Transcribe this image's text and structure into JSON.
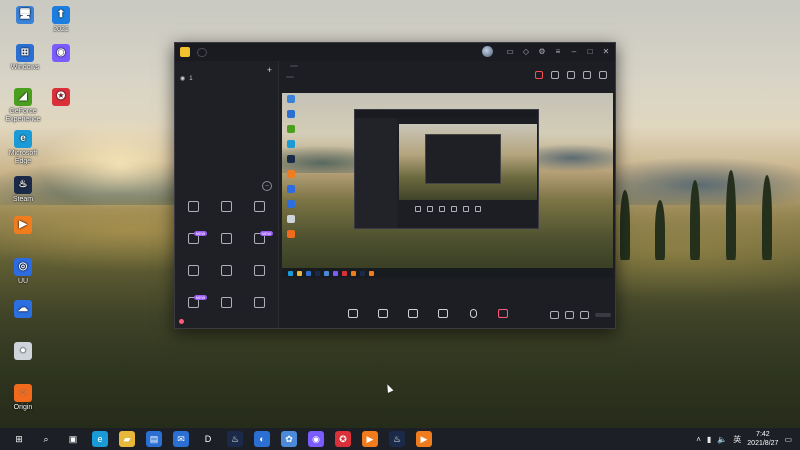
{
  "desktop": {
    "icons": [
      {
        "label": "",
        "color": "#3b82d9",
        "glyph": "🖥"
      },
      {
        "label": "2021",
        "color": "#1c7fe0",
        "glyph": "⬆"
      },
      {
        "label": "Windows",
        "color": "#2a6fd1",
        "glyph": "⊞"
      },
      {
        "label": "10",
        "color": "#2a6fd1",
        "glyph": ""
      },
      {
        "label": "",
        "color": "#7a5cff",
        "glyph": "◉"
      },
      {
        "label": "GeForce Experience",
        "color": "#4b9f1f",
        "glyph": "◢"
      },
      {
        "label": "",
        "color": "#d9303a",
        "glyph": "✪"
      },
      {
        "label": "Microsoft Edge",
        "color": "#1a9bd7",
        "glyph": "e"
      },
      {
        "label": "Steam",
        "color": "#1b2a48",
        "glyph": "♨"
      },
      {
        "label": "",
        "color": "#f07c1d",
        "glyph": "▶"
      },
      {
        "label": "UU",
        "color": "#2d6be0",
        "glyph": "◎"
      },
      {
        "label": "",
        "color": "#2b6fe0",
        "glyph": "☁"
      },
      {
        "label": "",
        "color": "#cfd3da",
        "glyph": "●"
      },
      {
        "label": "Origin",
        "color": "#f26b1d",
        "glyph": "◌"
      }
    ]
  },
  "app": {
    "title": "",
    "version_badge": "",
    "left": {
      "tabs": [
        "",
        "",
        ""
      ],
      "active_tab": 0,
      "scene_label": "1",
      "tools_title": "",
      "tools": [
        {
          "label": "",
          "tag": ""
        },
        {
          "label": "",
          "tag": ""
        },
        {
          "label": "",
          "tag": ""
        },
        {
          "label": "",
          "tag": "NEW"
        },
        {
          "label": "",
          "tag": ""
        },
        {
          "label": "",
          "tag": "NEW"
        },
        {
          "label": "",
          "tag": ""
        },
        {
          "label": "",
          "tag": ""
        },
        {
          "label": "",
          "tag": ""
        },
        {
          "label": "",
          "tag": "NEW"
        },
        {
          "label": "",
          "tag": ""
        },
        {
          "label": "",
          "tag": ""
        }
      ],
      "footer_text": ""
    },
    "main": {
      "heading": "",
      "heading_btn": "",
      "sub_items": [
        "",
        "",
        ""
      ],
      "controls": [
        "",
        "",
        "",
        "",
        "",
        ""
      ],
      "start_label": "",
      "status": [
        "",
        "",
        "",
        "",
        "",
        ""
      ]
    }
  },
  "taskbar": {
    "icons": [
      {
        "name": "windows-start-icon",
        "glyph": "⊞",
        "color": "#1c1f26"
      },
      {
        "name": "search-icon",
        "glyph": "⌕",
        "color": "#1c1f26"
      },
      {
        "name": "task-view-icon",
        "glyph": "▣",
        "color": "#1c1f26"
      },
      {
        "name": "edge-icon",
        "glyph": "e",
        "color": "#1a9bd7"
      },
      {
        "name": "file-explorer-icon",
        "glyph": "▰",
        "color": "#e8b83a"
      },
      {
        "name": "store-icon",
        "glyph": "▤",
        "color": "#2a6fd1"
      },
      {
        "name": "mail-icon",
        "glyph": "✉",
        "color": "#2a6fd1"
      },
      {
        "name": "dell-icon",
        "glyph": "D",
        "color": "#1c1f26"
      },
      {
        "name": "steam-icon",
        "glyph": "♨",
        "color": "#1b2a48"
      },
      {
        "name": "shield-icon",
        "glyph": "◐",
        "color": "#2a6fd1"
      },
      {
        "name": "app-icon-1",
        "glyph": "✿",
        "color": "#4a8ad9"
      },
      {
        "name": "app-icon-2",
        "glyph": "◉",
        "color": "#7a5cff"
      },
      {
        "name": "netease-music-icon",
        "glyph": "✪",
        "color": "#d9303a"
      },
      {
        "name": "live-assistant-icon",
        "glyph": "▶",
        "color": "#f07c1d"
      },
      {
        "name": "steam-icon-2",
        "glyph": "♨",
        "color": "#1b2a48"
      },
      {
        "name": "live-assistant-icon-2",
        "glyph": "▶",
        "color": "#f07c1d"
      }
    ],
    "time": "7:42",
    "date": "2021/8/27",
    "lang": "英"
  }
}
